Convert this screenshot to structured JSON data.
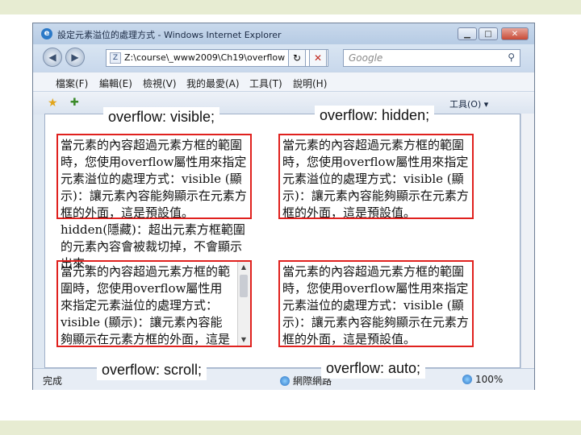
{
  "window": {
    "title": "設定元素溢位的處理方式 - Windows Internet Explorer",
    "btn_min": "▁",
    "btn_max": "□",
    "btn_close": "✕"
  },
  "address": {
    "url": "Z:\\course\\_www2009\\Ch19\\overflow",
    "search_placeholder": "Google"
  },
  "menu": {
    "file": "檔案(F)",
    "edit": "編輯(E)",
    "view": "檢視(V)",
    "favorites": "我的最愛(A)",
    "tools": "工具(T)",
    "help": "說明(H)"
  },
  "favbar": {
    "tools_label": "工具(O) ▾"
  },
  "demo": {
    "paragraph": "當元素的內容超過元素方框的範圍時，您使用overflow屬性用來指定元素溢位的處理方式：visible (顯示)：讓元素內容能夠顯示在元素方框的外面，這是預設值。hidden(隱藏)：超出元素方框範圍的元素內容會被裁切掉，不會顯示出來。",
    "label_visible": "overflow: visible;",
    "label_hidden": "overflow: hidden;",
    "label_scroll": "overflow: scroll;",
    "label_auto": "overflow: auto;"
  },
  "status": {
    "done": "完成",
    "zone": "網際網路",
    "zoom": "100%"
  },
  "colors": {
    "accent_border": "#e0211e"
  }
}
